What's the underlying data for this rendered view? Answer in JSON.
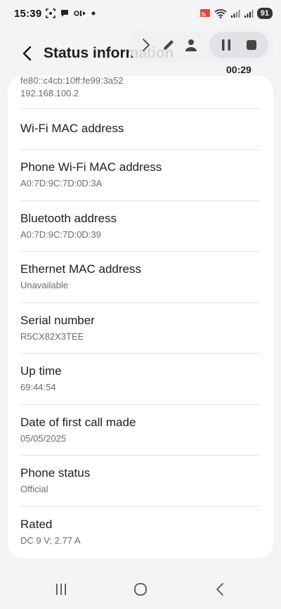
{
  "status_bar": {
    "time": "15:39",
    "battery": "91",
    "icons_left": [
      "screenshot-icon",
      "chat-icon",
      "media-icon",
      "dot-icon"
    ],
    "icons_right": [
      "cast-icon",
      "wifi-icon",
      "signal-icon",
      "signal-icon"
    ]
  },
  "header": {
    "title": "Status information"
  },
  "recorder": {
    "timer": "00:29"
  },
  "ip": {
    "ipv6": "fe80::c4cb:10ff:fe99:3a52",
    "ipv4": "192.168.100.2"
  },
  "rows": [
    {
      "title": "Wi-Fi MAC address",
      "value": ""
    },
    {
      "title": "Phone Wi-Fi MAC address",
      "value": "A0:7D:9C:7D:0D:3A"
    },
    {
      "title": "Bluetooth address",
      "value": "A0:7D:9C:7D:0D:39"
    },
    {
      "title": "Ethernet MAC address",
      "value": "Unavailable"
    },
    {
      "title": "Serial number",
      "value": "R5CX82X3TEE"
    },
    {
      "title": "Up time",
      "value": "69:44:54"
    },
    {
      "title": "Date of first call made",
      "value": "05/05/2025"
    },
    {
      "title": "Phone status",
      "value": "Official"
    },
    {
      "title": "Rated",
      "value": "DC 9 V; 2.77 A"
    }
  ],
  "colors": {
    "background": "#f4f4f6",
    "card": "#ffffff",
    "subtext": "#6b6b70"
  }
}
